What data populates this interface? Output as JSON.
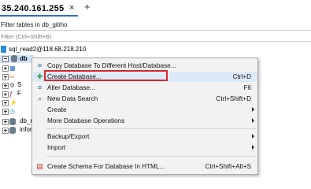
{
  "tab": {
    "title": "35.240.161.255",
    "close": "×",
    "add": "+"
  },
  "filter": {
    "label": "Filter tables in db_gitiho",
    "placeholder": "Filter (Ctrl+Shift+B)"
  },
  "tree": {
    "connection": "sql_read2@118.68.218.210",
    "db_label": "db",
    "children": [
      {
        "icon": "table-icon",
        "glyph": "▦",
        "label": "",
        "color": "#2a6ebb"
      },
      {
        "icon": "view-icon",
        "glyph": "∞",
        "label": "",
        "color": "#d07a1a"
      },
      {
        "icon": "procedure-icon",
        "glyph": "⚙",
        "label": "S",
        "color": "#5a5a5a"
      },
      {
        "icon": "function-icon",
        "glyph": "ƒ",
        "label": "F",
        "color": "#b02a2a"
      },
      {
        "icon": "trigger-icon",
        "glyph": "⚡",
        "label": "",
        "color": "#e0a020"
      },
      {
        "icon": "event-icon",
        "glyph": "◷",
        "label": "",
        "color": "#2a8bd1"
      }
    ],
    "siblings": [
      {
        "label": "db_r"
      },
      {
        "label": "infor"
      }
    ]
  },
  "menu": {
    "items": [
      {
        "name": "copy-database",
        "icon": "copy-database-icon",
        "glyph": "≡",
        "iconColor": "#2a6ebb",
        "label": "Copy Database To Different Host/Database...",
        "shortcut": "",
        "submenu": false
      },
      {
        "name": "create-database",
        "icon": "create-database-icon",
        "glyph": "✚",
        "iconColor": "#2f9e44",
        "label": "Create Database...",
        "shortcut": "Ctrl+D",
        "submenu": false,
        "highlighted": true
      },
      {
        "name": "alter-database",
        "icon": "alter-database-icon",
        "glyph": "≡",
        "iconColor": "#2a6ebb",
        "label": "Alter Database...",
        "shortcut": "F6",
        "submenu": false
      },
      {
        "name": "new-data-search",
        "icon": "data-search-icon",
        "glyph": "⌕",
        "iconColor": "#555555",
        "label": "New Data Search",
        "shortcut": "Ctrl+Shift+D",
        "submenu": false
      },
      {
        "name": "create",
        "icon": "",
        "glyph": "",
        "iconColor": "",
        "label": "Create",
        "shortcut": "",
        "submenu": true
      },
      {
        "name": "more-database-operations",
        "icon": "",
        "glyph": "",
        "iconColor": "",
        "label": "More Database Operations",
        "shortcut": "",
        "submenu": true
      },
      {
        "name": "backup-export",
        "icon": "",
        "glyph": "",
        "iconColor": "",
        "label": "Backup/Export",
        "shortcut": "",
        "submenu": true
      },
      {
        "name": "import",
        "icon": "",
        "glyph": "",
        "iconColor": "",
        "label": "Import",
        "shortcut": "",
        "submenu": true
      },
      {
        "name": "create-schema-html",
        "icon": "schema-html-icon",
        "glyph": "▤",
        "iconColor": "#c0392b",
        "label": "Create Schema For Database In HTML...",
        "shortcut": "Ctrl+Shift+Alt+S",
        "submenu": false
      }
    ]
  },
  "colors": {
    "accent": "#2b6fd1",
    "highlight_border": "#d9262a",
    "selection": "#cfe3f7"
  }
}
